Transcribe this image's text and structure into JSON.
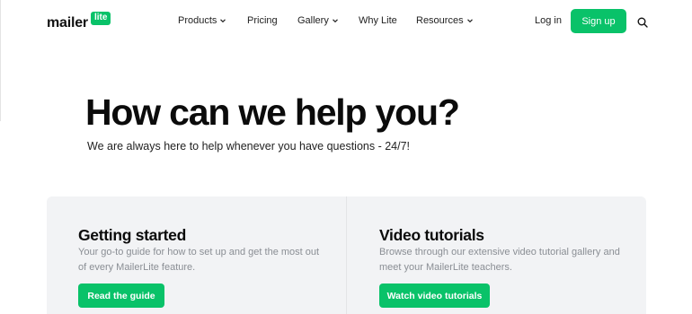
{
  "brand": {
    "word": "mailer",
    "badge": "lite",
    "color": "#09c269"
  },
  "nav": {
    "items": [
      {
        "label": "Products",
        "dropdown": true
      },
      {
        "label": "Pricing",
        "dropdown": false
      },
      {
        "label": "Gallery",
        "dropdown": true
      },
      {
        "label": "Why Lite",
        "dropdown": false
      },
      {
        "label": "Resources",
        "dropdown": true
      }
    ],
    "login": "Log in",
    "signup": "Sign up",
    "search_icon": "search-icon"
  },
  "hero": {
    "title": "How can we help you?",
    "subtitle": "We are always here to help whenever you have questions - 24/7!"
  },
  "cards": [
    {
      "title": "Getting started",
      "description": "Your go-to guide for how to set up and get the most out of every MailerLite feature.",
      "button": "Read the guide"
    },
    {
      "title": "Video tutorials",
      "description": "Browse through our extensive video tutorial gallery and meet your MailerLite teachers.",
      "button": "Watch video tutorials"
    }
  ]
}
